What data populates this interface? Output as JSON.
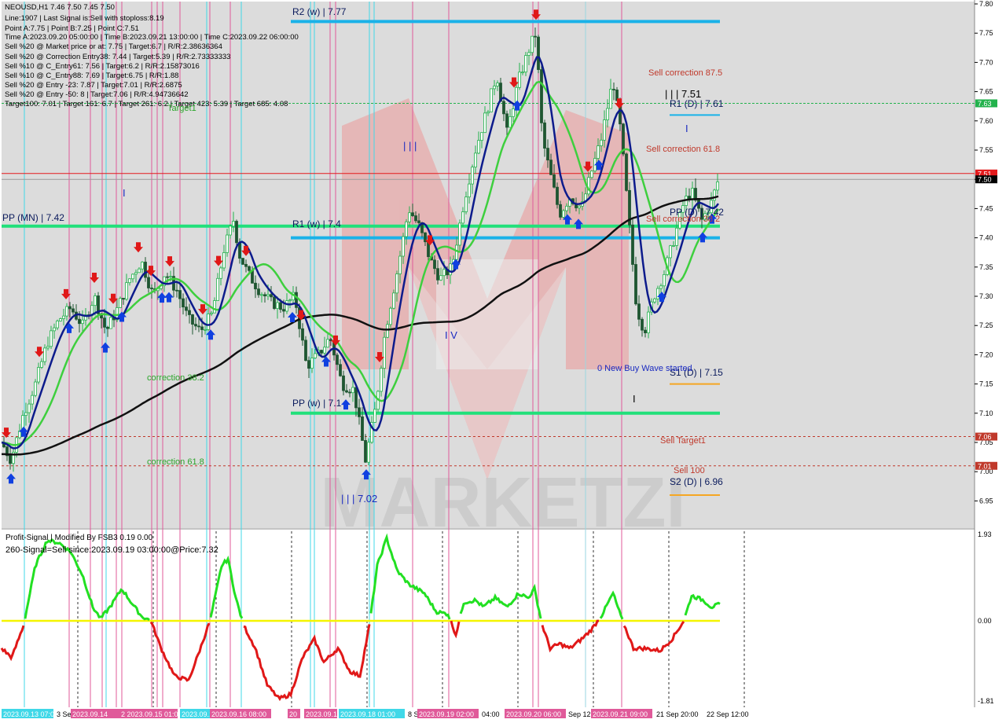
{
  "header": {
    "symbol_line": "NEOUSD,H1  7.46 7.50 7.45 7.50",
    "lines": [
      "Line:1907 | Last Signal is:Sell with stoploss:8.19",
      "Point A:7.75 | Point B:7.25 | Point C:7.51",
      "Time A:2023.09.20 05:00:00 | Time B:2023.09.21 13:00:00 | Time C:2023.09.22 06:00:00",
      "Sell %20 @ Market price or at: 7.75 | Target:6.7 | R/R:2.38636364",
      "Sell %20 @ Correction Entry38: 7.44 | Target:5.39 | R/R:2.73333333",
      "Sell %10 @ C_Entry61: 7.56 | Target:6.2 | R/R:2.15873016",
      "Sell %10 @ C_Entry88: 7.69 | Target:6.75 | R/R:1.88",
      "Sell %20 @ Entry -23: 7.87 | Target:7.01 | R/R:2.6875",
      "Sell %20 @ Entry -50: 8 | Target:7.06 | R/R:4.94736642",
      "Target100: 7.01 | Target 161: 6.7 | Target 261: 6.2 | Target 423: 5.39 | Target 685: 4.08"
    ]
  },
  "price_axis": {
    "ticks": [
      "7.80",
      "7.75",
      "7.70",
      "7.65",
      "7.60",
      "7.55",
      "7.50",
      "7.45",
      "7.40",
      "7.35",
      "7.30",
      "7.25",
      "7.20",
      "7.15",
      "7.10",
      "7.05",
      "7.00",
      "6.95"
    ],
    "tags": [
      {
        "label": "7.63",
        "color": "#22b24c"
      },
      {
        "label": "7.51",
        "color": "#e31a1c"
      },
      {
        "label": "7.50",
        "color": "#000000"
      },
      {
        "label": "7.06",
        "color": "#c0392b"
      },
      {
        "label": "7.01",
        "color": "#c0392b"
      }
    ]
  },
  "osc_axis": {
    "ticks": [
      "1.93",
      "0.00",
      "-1.81"
    ]
  },
  "levels": [
    {
      "label": "R2 (w) | 7.77",
      "color": "#1ab2e8"
    },
    {
      "label": "R1 (w) | 7.4",
      "color": "#1ab2e8"
    },
    {
      "label": "PP (MN) | 7.42",
      "color": "#21e07a"
    },
    {
      "label": "PP (w) | 7.1",
      "color": "#21e07a"
    },
    {
      "label": "R1 (D) | 7.61",
      "color": "#1ab2e8"
    },
    {
      "label": "PP (D) | 7.42",
      "color": "#1ab2e8"
    },
    {
      "label": "S1 (D) | 7.15",
      "color": "#f5a623"
    },
    {
      "label": "S2 (D) | 6.96",
      "color": "#f5a623"
    },
    {
      "label": "| | | 7.51",
      "color": "#000000"
    }
  ],
  "annotations": {
    "target1": "Target1",
    "correction382": "correction 38.2",
    "correction618": "correction 61.8",
    "sell_corr_875": "Sell correction 87.5",
    "sell_corr_618": "Sell correction 61.8",
    "sell_corr_382": "Sell correction 38.2",
    "sell_target1": "Sell Target1",
    "sell_100": "Sell 100",
    "new_wave": "0 New Buy Wave started",
    "wave_ii": "| | |",
    "wave_iii": "| | | 7.02",
    "wave_iv": "I V",
    "wave_i1": "I",
    "wave_i2": "I",
    "wave_i3": "I"
  },
  "osc": {
    "title": "Profit-Signal | Modified By FSB3 0.19 0.00",
    "signal": "260-Signal=Sell since:2023.09.19 03:00:00@Price:7.32"
  },
  "time_axis": {
    "labels": [
      "2023.09.13 07:00",
      "3 Se",
      "2023.09.14",
      "2 2023.09.15 01:0",
      "2023.09.1",
      "2023.09.16 08:00",
      "20",
      "2023.09.1",
      "2023.09.18 01:00",
      "8 S",
      "2023.09.19 02:00",
      "04:00",
      "2023.09.20 06:00",
      "Sep 12:",
      "2023.09.21 09:00",
      "21 Sep 20:00",
      "22 Sep 12:00"
    ]
  },
  "colors": {
    "bull_candle": "#22b24c",
    "bear_candle": "#1e5631",
    "ma_fast": "#0d1b8c",
    "ma_mid": "#3ecf3e",
    "ma_slow": "#111111",
    "osc_up": "#22e022",
    "osc_down": "#e01818",
    "osc_zero": "#f5f500",
    "buy_arrow": "#1040e0",
    "sell_arrow": "#e01818"
  },
  "chart_data": {
    "type": "line",
    "symbol": "NEOUSD",
    "timeframe": "H1",
    "title": "NEOUSD,H1",
    "ylim": [
      6.9,
      7.8
    ],
    "last": {
      "open": 7.46,
      "high": 7.5,
      "low": 7.45,
      "close": 7.5
    },
    "x": [
      "2023.09.13 07:00",
      "2023.09.14",
      "2023.09.15 01:00",
      "2023.09.16 08:00",
      "2023.09.18 01:00",
      "2023.09.19 02:00",
      "2023.09.20 06:00",
      "2023.09.21 09:00",
      "21 Sep 20:00",
      "22 Sep 12:00"
    ],
    "series": [
      {
        "values": [
          7.05,
          7.28,
          7.3,
          7.35,
          7.2,
          7.4,
          7.75,
          7.6,
          7.3,
          7.5
        ]
      }
    ],
    "points": {
      "A": 7.75,
      "B": 7.25,
      "C": 7.51
    },
    "levels": {
      "R2_w": 7.77,
      "R1_w": 7.4,
      "PP_MN": 7.42,
      "PP_w": 7.1,
      "R1_D": 7.61,
      "PP_D": 7.42,
      "S1_D": 7.15,
      "S2_D": 6.96
    },
    "oscillator": {
      "ylim": [
        -1.81,
        1.93
      ],
      "zero": 0.0
    }
  }
}
